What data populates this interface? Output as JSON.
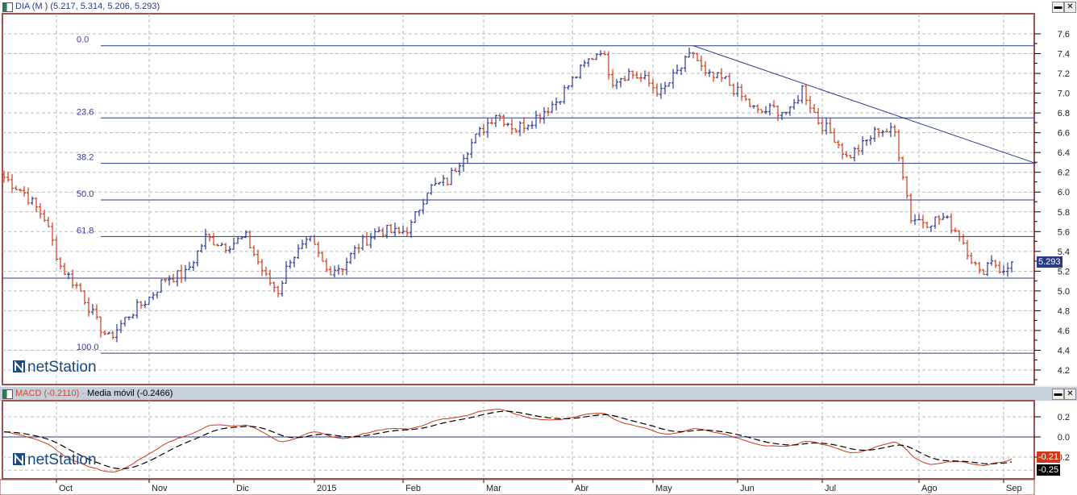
{
  "price_pane": {
    "title": "DIA (M ) (5.217, 5.314, 5.206, 5.293)",
    "last_price": "5.293",
    "last_price_value": 5.293,
    "yticks": [
      "7.6",
      "7.4",
      "7.2",
      "7.0",
      "6.8",
      "6.6",
      "6.4",
      "6.2",
      "6.0",
      "5.8",
      "5.6",
      "5.4",
      "5.2",
      "5.0",
      "4.8",
      "4.6",
      "4.4",
      "4.2"
    ],
    "fib": [
      {
        "label": "0.0",
        "price": 7.48
      },
      {
        "label": "23.6",
        "price": 6.75
      },
      {
        "label": "38.2",
        "price": 6.29
      },
      {
        "label": "50.0",
        "price": 5.92
      },
      {
        "label": "61.8",
        "price": 5.55
      },
      {
        "label": "100.0",
        "price": 4.37
      }
    ],
    "support_price": 5.13,
    "trendline": {
      "from": [
        171,
        7.48
      ],
      "to": [
        256,
        6.29
      ]
    },
    "logo": "netStation"
  },
  "macd_pane": {
    "macd_label": "MACD (-0.2110)",
    "sep": " - ",
    "signal_label": "Media móvil (-0.2466)",
    "yticks": [
      "0.2",
      "0.0",
      "0.2"
    ],
    "macd_badge": "-0.21",
    "signal_badge": "-0.25",
    "logo": "netStation"
  },
  "x_axis": {
    "months": [
      {
        "label": "Oct",
        "bar": 13
      },
      {
        "label": "Nov",
        "bar": 36
      },
      {
        "label": "Dic",
        "bar": 57
      },
      {
        "label": "2015",
        "bar": 77
      },
      {
        "label": "Feb",
        "bar": 99
      },
      {
        "label": "Mar",
        "bar": 119
      },
      {
        "label": "Abr",
        "bar": 141
      },
      {
        "label": "May",
        "bar": 161
      },
      {
        "label": "Jun",
        "bar": 182
      },
      {
        "label": "Jul",
        "bar": 203
      },
      {
        "label": "Ago",
        "bar": 227
      },
      {
        "label": "Sep",
        "bar": 248
      }
    ]
  },
  "colors": {
    "up": "#2a3a9a",
    "down": "#cc3a1a",
    "line": "#2a3a8a",
    "frame": "#a05050",
    "macd": "#cc3a1a",
    "signal": "#000000"
  },
  "chart_data": {
    "type": "ohlc",
    "title": "DIA (M )",
    "ohlc_last": [
      5.217,
      5.314,
      5.206,
      5.293
    ],
    "close_waypoints": [
      [
        0,
        6.15
      ],
      [
        5,
        5.99
      ],
      [
        10,
        5.74
      ],
      [
        14,
        5.25
      ],
      [
        19,
        5.0
      ],
      [
        23,
        4.68
      ],
      [
        26,
        4.52
      ],
      [
        31,
        4.76
      ],
      [
        36,
        4.93
      ],
      [
        40,
        5.13
      ],
      [
        45,
        5.17
      ],
      [
        50,
        5.54
      ],
      [
        55,
        5.46
      ],
      [
        60,
        5.54
      ],
      [
        65,
        5.13
      ],
      [
        68,
        5.0
      ],
      [
        71,
        5.33
      ],
      [
        76,
        5.5
      ],
      [
        80,
        5.21
      ],
      [
        84,
        5.25
      ],
      [
        88,
        5.46
      ],
      [
        93,
        5.62
      ],
      [
        98,
        5.58
      ],
      [
        101,
        5.66
      ],
      [
        105,
        6.03
      ],
      [
        110,
        6.11
      ],
      [
        114,
        6.39
      ],
      [
        118,
        6.6
      ],
      [
        122,
        6.8
      ],
      [
        127,
        6.64
      ],
      [
        132,
        6.76
      ],
      [
        137,
        6.92
      ],
      [
        141,
        7.13
      ],
      [
        145,
        7.33
      ],
      [
        148,
        7.45
      ],
      [
        151,
        7.13
      ],
      [
        155,
        7.21
      ],
      [
        159,
        7.13
      ],
      [
        163,
        7.0
      ],
      [
        167,
        7.21
      ],
      [
        171,
        7.41
      ],
      [
        174,
        7.17
      ],
      [
        179,
        7.13
      ],
      [
        183,
        6.96
      ],
      [
        187,
        6.8
      ],
      [
        191,
        6.84
      ],
      [
        195,
        6.8
      ],
      [
        198,
        7.05
      ],
      [
        202,
        6.72
      ],
      [
        206,
        6.56
      ],
      [
        209,
        6.35
      ],
      [
        213,
        6.47
      ],
      [
        217,
        6.64
      ],
      [
        221,
        6.6
      ],
      [
        223,
        6.19
      ],
      [
        225,
        5.74
      ],
      [
        229,
        5.7
      ],
      [
        233,
        5.74
      ],
      [
        237,
        5.58
      ],
      [
        240,
        5.33
      ],
      [
        242,
        5.17
      ],
      [
        245,
        5.33
      ],
      [
        248,
        5.17
      ],
      [
        250,
        5.29
      ]
    ],
    "ylim": [
      4.1,
      7.7
    ],
    "macd_ylim": [
      -0.36,
      0.36
    ],
    "indicator": "MACD 12/26/9"
  }
}
